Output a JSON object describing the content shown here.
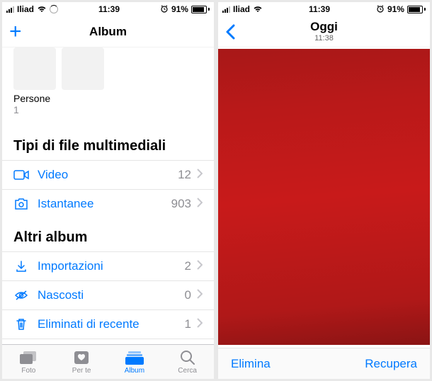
{
  "status": {
    "carrier": "Iliad",
    "time": "11:39",
    "battery_percent": "91%"
  },
  "left": {
    "nav_title": "Album",
    "persone_label": "Persone",
    "persone_count": "1",
    "section_media": "Tipi di file multimediali",
    "rows_media": [
      {
        "label": "Video",
        "count": "12"
      },
      {
        "label": "Istantanee",
        "count": "903"
      }
    ],
    "section_other": "Altri album",
    "rows_other": [
      {
        "label": "Importazioni",
        "count": "2"
      },
      {
        "label": "Nascosti",
        "count": "0"
      },
      {
        "label": "Eliminati di recente",
        "count": "1"
      }
    ],
    "tabs": [
      {
        "label": "Foto"
      },
      {
        "label": "Per te"
      },
      {
        "label": "Album"
      },
      {
        "label": "Cerca"
      }
    ]
  },
  "right": {
    "nav_title": "Oggi",
    "nav_subtitle": "11:38",
    "delete_label": "Elimina",
    "recover_label": "Recupera"
  }
}
